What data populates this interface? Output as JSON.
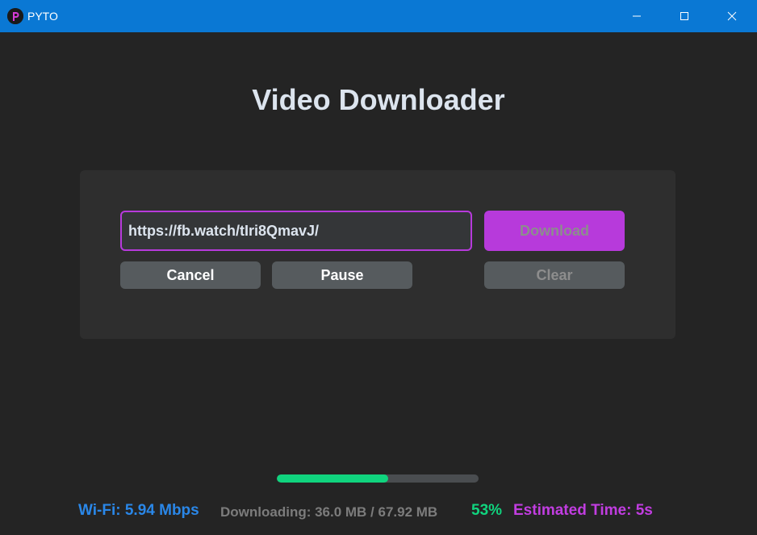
{
  "window": {
    "title": "PYTO",
    "icon_letter": "P"
  },
  "heading": "Video Downloader",
  "form": {
    "url_value": "https://fb.watch/tIri8QmavJ/",
    "download_label": "Download",
    "cancel_label": "Cancel",
    "pause_label": "Pause",
    "clear_label": "Clear"
  },
  "progress": {
    "fraction": 0.55
  },
  "status": {
    "wifi": "Wi-Fi: 5.94 Mbps",
    "downloading": "Downloading: 36.0 MB / 67.92 MB",
    "percent": "53%",
    "eta": "Estimated Time: 5s"
  },
  "colors": {
    "titlebar": "#0a78d4",
    "accent": "#b73adb",
    "progress": "#10d47e",
    "wifi": "#2a87e8"
  },
  "icons": {
    "minimize": "minimize-icon",
    "maximize": "maximize-icon",
    "close": "close-icon"
  }
}
